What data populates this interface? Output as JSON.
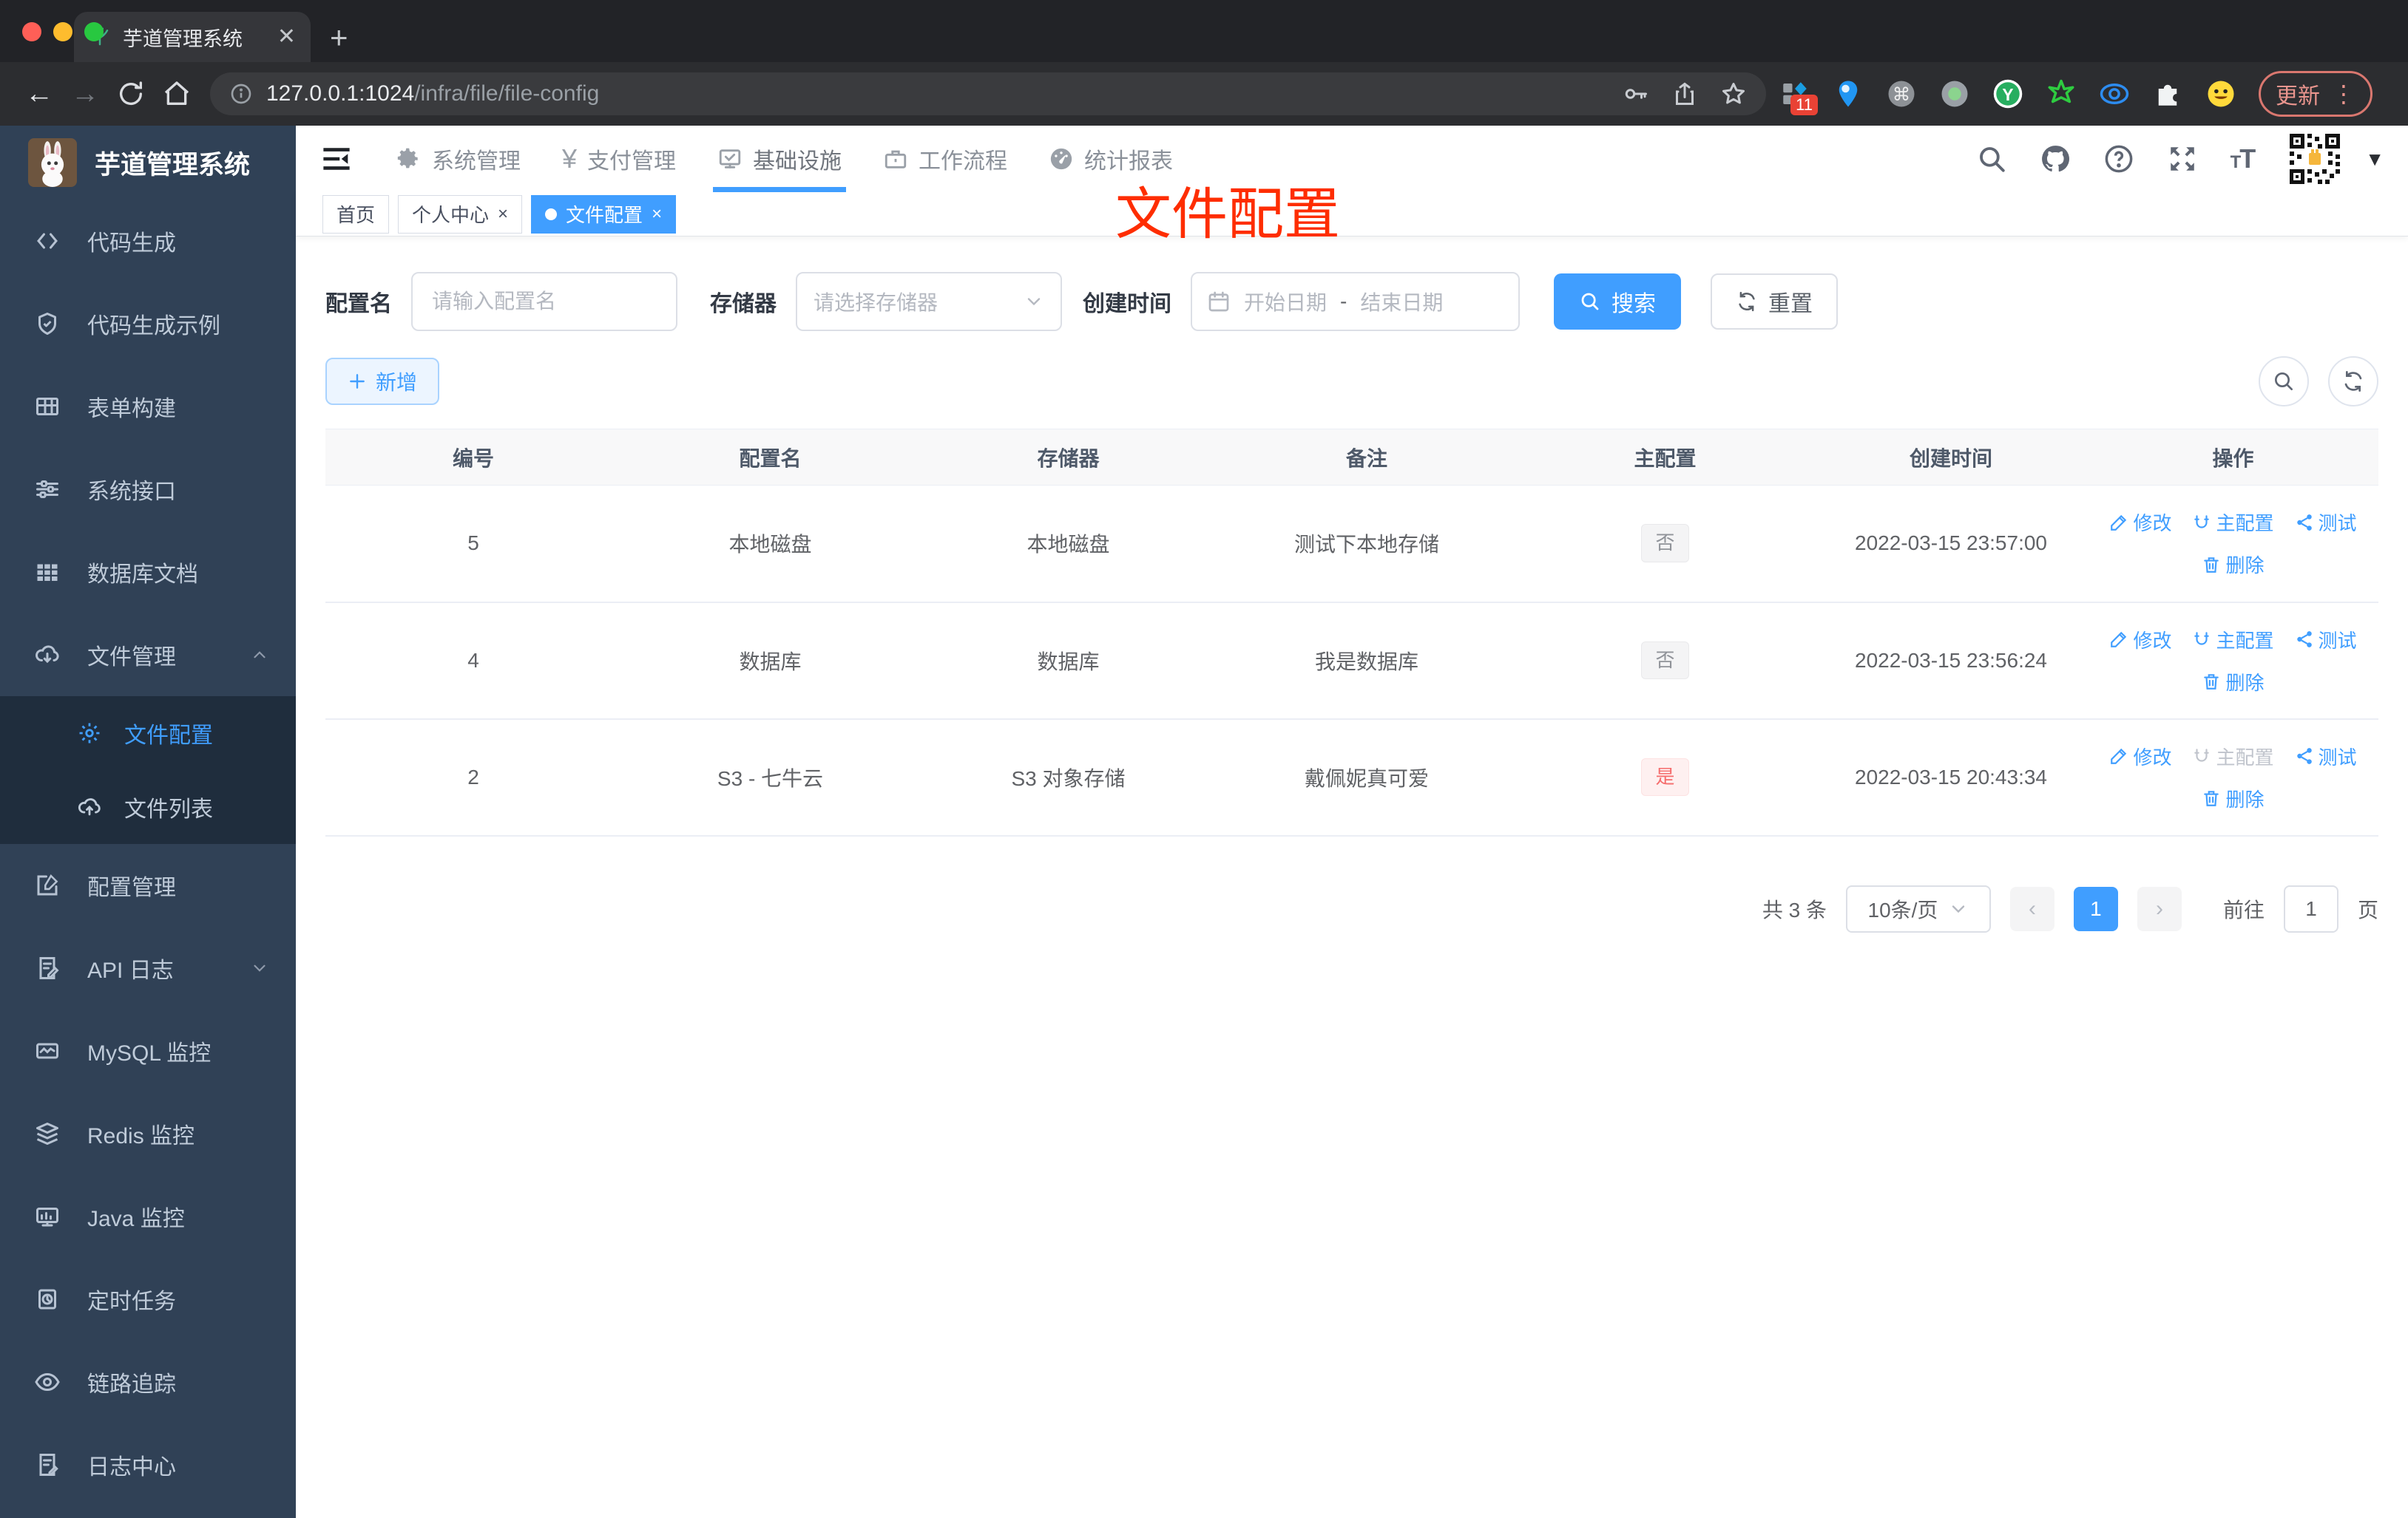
{
  "colors": {
    "accent": "#409eff",
    "danger": "#f56c6c",
    "annotation": "#fe2d00",
    "sidebar_bg": "#304156",
    "submenu_bg": "#1f2d3d"
  },
  "browser": {
    "tab_title": "芋道管理系统",
    "url_host": "127.0.0.1:1024",
    "url_path": "/infra/file/file-config",
    "ext_badge": "11",
    "update_label": "更新"
  },
  "sidebar": {
    "title": "芋道管理系统",
    "items": [
      {
        "label": "代码生成"
      },
      {
        "label": "代码生成示例"
      },
      {
        "label": "表单构建"
      },
      {
        "label": "系统接口"
      },
      {
        "label": "数据库文档"
      },
      {
        "label": "文件管理"
      }
    ],
    "submenu": [
      {
        "label": "文件配置"
      },
      {
        "label": "文件列表"
      }
    ],
    "items2": [
      {
        "label": "配置管理"
      },
      {
        "label": "API 日志"
      },
      {
        "label": "MySQL 监控"
      },
      {
        "label": "Redis 监控"
      },
      {
        "label": "Java 监控"
      },
      {
        "label": "定时任务"
      },
      {
        "label": "链路追踪"
      },
      {
        "label": "日志中心"
      }
    ]
  },
  "nav": {
    "items": [
      {
        "label": "系统管理"
      },
      {
        "label": "支付管理"
      },
      {
        "label": "基础设施"
      },
      {
        "label": "工作流程"
      },
      {
        "label": "统计报表"
      }
    ]
  },
  "tabs": [
    {
      "label": "首页"
    },
    {
      "label": "个人中心"
    },
    {
      "label": "文件配置"
    }
  ],
  "annotation": {
    "text": "文件配置"
  },
  "filter": {
    "name_label": "配置名",
    "name_placeholder": "请输入配置名",
    "storage_label": "存储器",
    "storage_placeholder": "请选择存储器",
    "date_label": "创建时间",
    "date_start": "开始日期",
    "date_sep": "-",
    "date_end": "结束日期",
    "search": "搜索",
    "reset": "重置"
  },
  "toolbar": {
    "add": "新增"
  },
  "table": {
    "headers": [
      "编号",
      "配置名",
      "存储器",
      "备注",
      "主配置",
      "创建时间",
      "操作"
    ],
    "actions": {
      "edit": "修改",
      "master": "主配置",
      "test": "测试",
      "del": "删除"
    },
    "rows": [
      {
        "id": "5",
        "name": "本地磁盘",
        "storage": "本地磁盘",
        "remark": "测试下本地存储",
        "master": "否",
        "created": "2022-03-15 23:57:00"
      },
      {
        "id": "4",
        "name": "数据库",
        "storage": "数据库",
        "remark": "我是数据库",
        "master": "否",
        "created": "2022-03-15 23:56:24"
      },
      {
        "id": "2",
        "name": "S3 - 七牛云",
        "storage": "S3 对象存储",
        "remark": "戴佩妮真可爱",
        "master": "是",
        "created": "2022-03-15 20:43:34"
      }
    ]
  },
  "pagination": {
    "total": "共 3 条",
    "page_size": "10条/页",
    "current": "1",
    "goto_label": "前往",
    "goto_value": "1",
    "unit": "页"
  }
}
